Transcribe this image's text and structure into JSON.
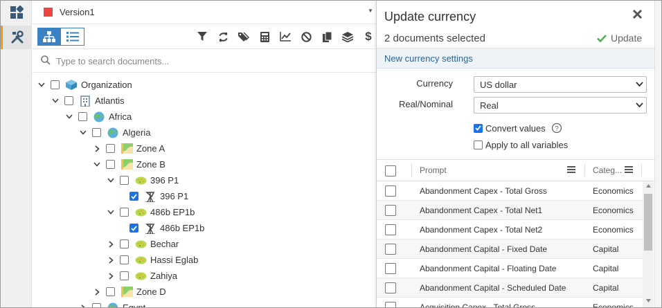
{
  "version": {
    "label": "Version1",
    "color": "#ef4444"
  },
  "search": {
    "placeholder": "Type to search documents..."
  },
  "tree": [
    {
      "label": "Organization",
      "icon": "organization-cube-icon",
      "expanded": true,
      "checked": false
    },
    {
      "label": "Atlantis",
      "icon": "building-icon",
      "expanded": true,
      "checked": false
    },
    {
      "label": "Africa",
      "icon": "globe-icon",
      "expanded": true,
      "checked": false
    },
    {
      "label": "Algeria",
      "icon": "globe-icon",
      "expanded": true,
      "checked": false
    },
    {
      "label": "Zone A",
      "icon": "zone-map-icon",
      "expanded": false,
      "checked": false
    },
    {
      "label": "Zone B",
      "icon": "zone-map-icon",
      "expanded": true,
      "checked": false
    },
    {
      "label": "396 P1",
      "icon": "field-icon",
      "expanded": true,
      "checked": false
    },
    {
      "label": "396 P1",
      "icon": "well-icon",
      "checked": true
    },
    {
      "label": "486b EP1b",
      "icon": "field-icon",
      "expanded": true,
      "checked": false
    },
    {
      "label": "486b EP1b",
      "icon": "well-icon",
      "checked": true
    },
    {
      "label": "Bechar",
      "icon": "field-icon",
      "expanded": false,
      "checked": false
    },
    {
      "label": "Hassi Eglab",
      "icon": "field-icon",
      "expanded": false,
      "checked": false
    },
    {
      "label": "Zahiya",
      "icon": "field-icon",
      "expanded": false,
      "checked": false
    },
    {
      "label": "Zone D",
      "icon": "zone-map-icon",
      "expanded": false,
      "checked": false
    },
    {
      "label": "Egypt",
      "icon": "globe-icon",
      "expanded": false,
      "checked": false
    }
  ],
  "panel": {
    "title": "Update currency",
    "selected_count": "2 documents selected",
    "update_label": "Update",
    "section_title": "New currency settings",
    "currency_label": "Currency",
    "currency_value": "US dollar",
    "realnominal_label": "Real/Nominal",
    "realnominal_value": "Real",
    "convert_values_label": "Convert values",
    "convert_values_checked": true,
    "apply_all_label": "Apply to all variables",
    "apply_all_checked": false
  },
  "grid": {
    "col_prompt": "Prompt",
    "col_category": "Categ...",
    "rows": [
      {
        "prompt": "Abandonment Capex - Total Gross",
        "category": "Economics"
      },
      {
        "prompt": "Abandonment Capex - Total Net1",
        "category": "Economics"
      },
      {
        "prompt": "Abandonment Capex - Total Net2",
        "category": "Economics"
      },
      {
        "prompt": "Abandonment Capital - Fixed Date",
        "category": "Capital"
      },
      {
        "prompt": "Abandonment Capital - Floating Date",
        "category": "Capital"
      },
      {
        "prompt": "Abandonment Capital - Scheduled Date",
        "category": "Capital"
      },
      {
        "prompt": "Acquisition Capex - Total Gross",
        "category": "Economics"
      }
    ]
  },
  "colors": {
    "accent": "#3b82c4",
    "checkbox": "#1a73e8",
    "rail_accent": "#f39c12",
    "section_bg": "#eef3f7",
    "update_check": "#4caf50"
  }
}
